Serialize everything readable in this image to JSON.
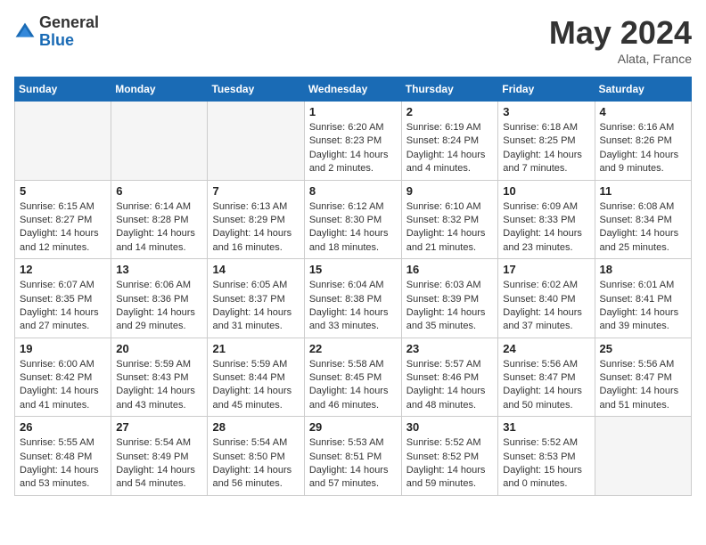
{
  "header": {
    "logo_general": "General",
    "logo_blue": "Blue",
    "month_title": "May 2024",
    "location": "Alata, France"
  },
  "weekdays": [
    "Sunday",
    "Monday",
    "Tuesday",
    "Wednesday",
    "Thursday",
    "Friday",
    "Saturday"
  ],
  "weeks": [
    [
      {
        "day": "",
        "empty": true
      },
      {
        "day": "",
        "empty": true
      },
      {
        "day": "",
        "empty": true
      },
      {
        "day": "1",
        "sunrise": "Sunrise: 6:20 AM",
        "sunset": "Sunset: 8:23 PM",
        "daylight": "Daylight: 14 hours and 2 minutes."
      },
      {
        "day": "2",
        "sunrise": "Sunrise: 6:19 AM",
        "sunset": "Sunset: 8:24 PM",
        "daylight": "Daylight: 14 hours and 4 minutes."
      },
      {
        "day": "3",
        "sunrise": "Sunrise: 6:18 AM",
        "sunset": "Sunset: 8:25 PM",
        "daylight": "Daylight: 14 hours and 7 minutes."
      },
      {
        "day": "4",
        "sunrise": "Sunrise: 6:16 AM",
        "sunset": "Sunset: 8:26 PM",
        "daylight": "Daylight: 14 hours and 9 minutes."
      }
    ],
    [
      {
        "day": "5",
        "sunrise": "Sunrise: 6:15 AM",
        "sunset": "Sunset: 8:27 PM",
        "daylight": "Daylight: 14 hours and 12 minutes."
      },
      {
        "day": "6",
        "sunrise": "Sunrise: 6:14 AM",
        "sunset": "Sunset: 8:28 PM",
        "daylight": "Daylight: 14 hours and 14 minutes."
      },
      {
        "day": "7",
        "sunrise": "Sunrise: 6:13 AM",
        "sunset": "Sunset: 8:29 PM",
        "daylight": "Daylight: 14 hours and 16 minutes."
      },
      {
        "day": "8",
        "sunrise": "Sunrise: 6:12 AM",
        "sunset": "Sunset: 8:30 PM",
        "daylight": "Daylight: 14 hours and 18 minutes."
      },
      {
        "day": "9",
        "sunrise": "Sunrise: 6:10 AM",
        "sunset": "Sunset: 8:32 PM",
        "daylight": "Daylight: 14 hours and 21 minutes."
      },
      {
        "day": "10",
        "sunrise": "Sunrise: 6:09 AM",
        "sunset": "Sunset: 8:33 PM",
        "daylight": "Daylight: 14 hours and 23 minutes."
      },
      {
        "day": "11",
        "sunrise": "Sunrise: 6:08 AM",
        "sunset": "Sunset: 8:34 PM",
        "daylight": "Daylight: 14 hours and 25 minutes."
      }
    ],
    [
      {
        "day": "12",
        "sunrise": "Sunrise: 6:07 AM",
        "sunset": "Sunset: 8:35 PM",
        "daylight": "Daylight: 14 hours and 27 minutes."
      },
      {
        "day": "13",
        "sunrise": "Sunrise: 6:06 AM",
        "sunset": "Sunset: 8:36 PM",
        "daylight": "Daylight: 14 hours and 29 minutes."
      },
      {
        "day": "14",
        "sunrise": "Sunrise: 6:05 AM",
        "sunset": "Sunset: 8:37 PM",
        "daylight": "Daylight: 14 hours and 31 minutes."
      },
      {
        "day": "15",
        "sunrise": "Sunrise: 6:04 AM",
        "sunset": "Sunset: 8:38 PM",
        "daylight": "Daylight: 14 hours and 33 minutes."
      },
      {
        "day": "16",
        "sunrise": "Sunrise: 6:03 AM",
        "sunset": "Sunset: 8:39 PM",
        "daylight": "Daylight: 14 hours and 35 minutes."
      },
      {
        "day": "17",
        "sunrise": "Sunrise: 6:02 AM",
        "sunset": "Sunset: 8:40 PM",
        "daylight": "Daylight: 14 hours and 37 minutes."
      },
      {
        "day": "18",
        "sunrise": "Sunrise: 6:01 AM",
        "sunset": "Sunset: 8:41 PM",
        "daylight": "Daylight: 14 hours and 39 minutes."
      }
    ],
    [
      {
        "day": "19",
        "sunrise": "Sunrise: 6:00 AM",
        "sunset": "Sunset: 8:42 PM",
        "daylight": "Daylight: 14 hours and 41 minutes."
      },
      {
        "day": "20",
        "sunrise": "Sunrise: 5:59 AM",
        "sunset": "Sunset: 8:43 PM",
        "daylight": "Daylight: 14 hours and 43 minutes."
      },
      {
        "day": "21",
        "sunrise": "Sunrise: 5:59 AM",
        "sunset": "Sunset: 8:44 PM",
        "daylight": "Daylight: 14 hours and 45 minutes."
      },
      {
        "day": "22",
        "sunrise": "Sunrise: 5:58 AM",
        "sunset": "Sunset: 8:45 PM",
        "daylight": "Daylight: 14 hours and 46 minutes."
      },
      {
        "day": "23",
        "sunrise": "Sunrise: 5:57 AM",
        "sunset": "Sunset: 8:46 PM",
        "daylight": "Daylight: 14 hours and 48 minutes."
      },
      {
        "day": "24",
        "sunrise": "Sunrise: 5:56 AM",
        "sunset": "Sunset: 8:47 PM",
        "daylight": "Daylight: 14 hours and 50 minutes."
      },
      {
        "day": "25",
        "sunrise": "Sunrise: 5:56 AM",
        "sunset": "Sunset: 8:47 PM",
        "daylight": "Daylight: 14 hours and 51 minutes."
      }
    ],
    [
      {
        "day": "26",
        "sunrise": "Sunrise: 5:55 AM",
        "sunset": "Sunset: 8:48 PM",
        "daylight": "Daylight: 14 hours and 53 minutes."
      },
      {
        "day": "27",
        "sunrise": "Sunrise: 5:54 AM",
        "sunset": "Sunset: 8:49 PM",
        "daylight": "Daylight: 14 hours and 54 minutes."
      },
      {
        "day": "28",
        "sunrise": "Sunrise: 5:54 AM",
        "sunset": "Sunset: 8:50 PM",
        "daylight": "Daylight: 14 hours and 56 minutes."
      },
      {
        "day": "29",
        "sunrise": "Sunrise: 5:53 AM",
        "sunset": "Sunset: 8:51 PM",
        "daylight": "Daylight: 14 hours and 57 minutes."
      },
      {
        "day": "30",
        "sunrise": "Sunrise: 5:52 AM",
        "sunset": "Sunset: 8:52 PM",
        "daylight": "Daylight: 14 hours and 59 minutes."
      },
      {
        "day": "31",
        "sunrise": "Sunrise: 5:52 AM",
        "sunset": "Sunset: 8:53 PM",
        "daylight": "Daylight: 15 hours and 0 minutes."
      },
      {
        "day": "",
        "empty": true
      }
    ]
  ]
}
